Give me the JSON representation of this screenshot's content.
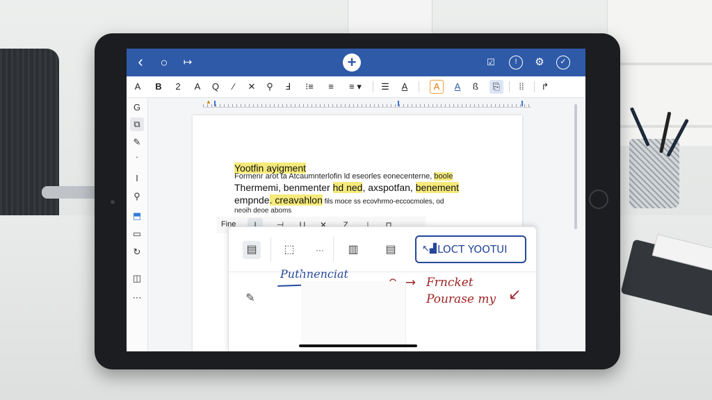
{
  "titlebar": {
    "back_icon": "chevron-left-icon",
    "circle_icon": "circle-icon",
    "redo_icon": "arrow-right-icon",
    "add_icon": "plus-icon",
    "right_icons": [
      "present-icon",
      "info-icon",
      "settings-icon",
      "check-icon"
    ],
    "back_glyph": "‹",
    "circle_glyph": "○",
    "redo_glyph": "↦",
    "add_glyph": "+",
    "present_glyph": "☑",
    "info_glyph": "!",
    "settings_glyph": "⚙",
    "check_glyph": "✓"
  },
  "toolbar": {
    "tools": [
      "A",
      "B",
      "2",
      "A",
      "Q",
      "⁄",
      "✕",
      "⚲",
      "Ⅎ",
      "⁝≡",
      "≡",
      "≡ ▾",
      "☰",
      "A",
      "A",
      "A",
      "ß",
      "⎘",
      "⁞⁞",
      "↱"
    ]
  },
  "sidebar": {
    "icons": [
      "G",
      "⧉",
      "✎",
      "ˋ",
      "I",
      "⚲",
      "⬒",
      "▭",
      "↻",
      "◫",
      "⋯"
    ]
  },
  "document": {
    "title": "Yootfin ayigment",
    "line1": "Formenr arot ta Atcaumnterlofin ld eseorles eonecenterne,",
    "line1_hl": "boole",
    "big_line_pre": "Thermemi, benmenter",
    "big_line_hl1": "hd ned",
    "big_line_mid": ", axspotfan,",
    "big_line_hl2": "benement",
    "big2_pre": "empnde",
    "big2_hl": ". creavahlon",
    "big2_small": "  fils moce ss ecovhrmo-eccocmoles, od",
    "line4": "neoih deoe aboms",
    "line5": "- - - - - - - - - - - - - - - - - - - - - - - - - - - - - - - - - - - - -"
  },
  "float_toolbar": {
    "label": "Fine",
    "icons": [
      "I",
      "⊣",
      "U",
      "✕",
      "Z",
      "⊥",
      "⊓"
    ]
  },
  "panel": {
    "icons": [
      "document-icon",
      "crop-icon",
      "more-icon",
      "page-icon",
      "list-icon"
    ],
    "more_label": "···",
    "loct_label": "LOCT YOOTUI",
    "handwriting_blue": "Puthnenciat",
    "handwriting_red1": "Frncket",
    "handwriting_red2": "Pourase my",
    "edit_icon": "edit-note-icon"
  }
}
